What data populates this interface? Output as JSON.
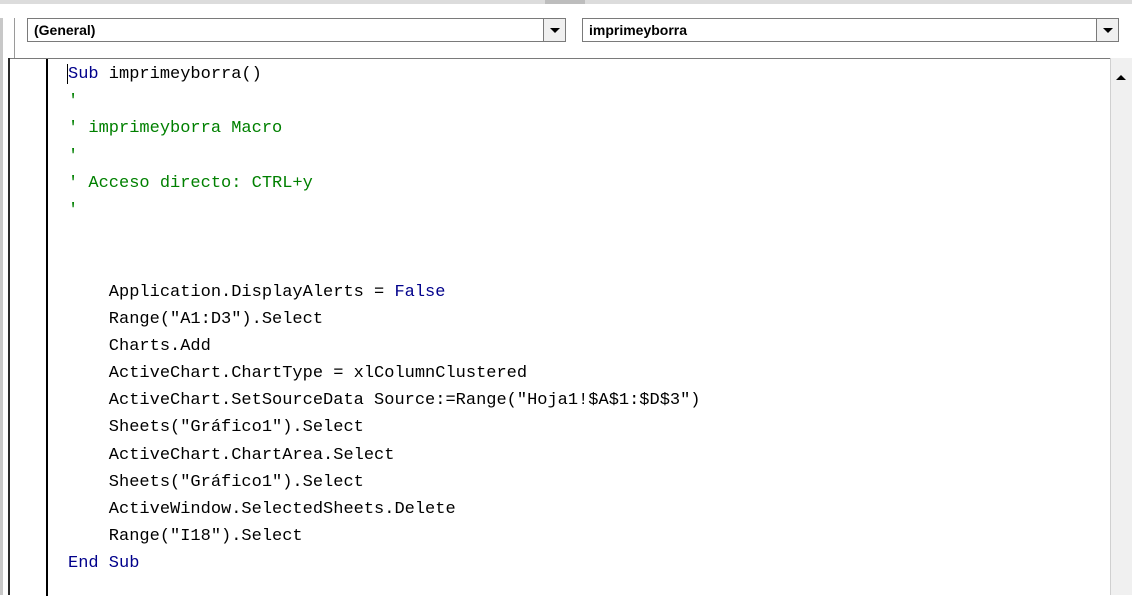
{
  "object_combo": {
    "value": "(General)"
  },
  "procedure_combo": {
    "value": "imprimeyborra"
  },
  "code_lines": [
    [
      {
        "t": "Sub",
        "c": "kw"
      },
      {
        "t": " imprimeyborra()",
        "c": ""
      }
    ],
    [
      {
        "t": "'",
        "c": "cm"
      }
    ],
    [
      {
        "t": "' imprimeyborra Macro",
        "c": "cm"
      }
    ],
    [
      {
        "t": "'",
        "c": "cm"
      }
    ],
    [
      {
        "t": "' Acceso directo: CTRL+y",
        "c": "cm"
      }
    ],
    [
      {
        "t": "'",
        "c": "cm"
      }
    ],
    [
      {
        "t": "",
        "c": ""
      }
    ],
    [
      {
        "t": "",
        "c": ""
      }
    ],
    [
      {
        "t": "    Application.DisplayAlerts = ",
        "c": ""
      },
      {
        "t": "False",
        "c": "kw"
      }
    ],
    [
      {
        "t": "    Range(\"A1:D3\").Select",
        "c": ""
      }
    ],
    [
      {
        "t": "    Charts.Add",
        "c": ""
      }
    ],
    [
      {
        "t": "    ActiveChart.ChartType = xlColumnClustered",
        "c": ""
      }
    ],
    [
      {
        "t": "    ActiveChart.SetSourceData Source:=Range(\"Hoja1!$A$1:$D$3\")",
        "c": ""
      }
    ],
    [
      {
        "t": "    Sheets(\"Gráfico1\").Select",
        "c": ""
      }
    ],
    [
      {
        "t": "    ActiveChart.ChartArea.Select",
        "c": ""
      }
    ],
    [
      {
        "t": "    Sheets(\"Gráfico1\").Select",
        "c": ""
      }
    ],
    [
      {
        "t": "    ActiveWindow.SelectedSheets.Delete",
        "c": ""
      }
    ],
    [
      {
        "t": "    Range(\"I18\").Select",
        "c": ""
      }
    ],
    [
      {
        "t": "End Sub",
        "c": "kw"
      }
    ]
  ],
  "colors": {
    "keyword": "#00008b",
    "comment": "#008000",
    "text": "#000000"
  },
  "icons": {
    "dropdown": "chevron-down-icon",
    "scroll_up": "scroll-up-icon"
  }
}
